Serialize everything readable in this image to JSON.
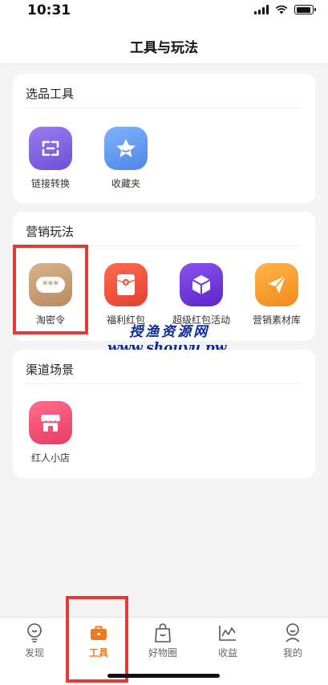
{
  "status_bar": {
    "time": "10:31"
  },
  "header": {
    "title": "工具与玩法"
  },
  "sections": [
    {
      "title": "选品工具",
      "items": [
        {
          "label": "链接转换",
          "icon": "link-convert-icon",
          "color": "#7b5fe3"
        },
        {
          "label": "收藏夹",
          "icon": "star-icon",
          "color": "#5f95ef"
        }
      ]
    },
    {
      "title": "营销玩法",
      "items": [
        {
          "label": "淘密令",
          "icon": "password-dots-icon",
          "color": "#c9a074"
        },
        {
          "label": "福利红包",
          "icon": "red-envelope-icon",
          "color": "#ef5139"
        },
        {
          "label": "超级红包活动",
          "icon": "cube-icon",
          "color": "#6e37da"
        },
        {
          "label": "营销素材库",
          "icon": "paper-plane-icon",
          "color": "#f79f2f"
        }
      ]
    },
    {
      "title": "渠道场景",
      "items": [
        {
          "label": "红人小店",
          "icon": "shop-icon",
          "color": "#ef5276"
        }
      ]
    }
  ],
  "watermark": {
    "line1": "授渔资源网",
    "line2": "www.shouyu.pw"
  },
  "tabs": [
    {
      "label": "发现",
      "icon": "bulb-icon",
      "active": false
    },
    {
      "label": "工具",
      "icon": "briefcase-icon",
      "active": true
    },
    {
      "label": "好物圈",
      "icon": "bag-icon",
      "active": false
    },
    {
      "label": "收益",
      "icon": "chart-icon",
      "active": false
    },
    {
      "label": "我的",
      "icon": "user-icon",
      "active": false
    }
  ],
  "colors": {
    "accent": "#f07a1f",
    "highlight": "#e83a34",
    "watermark": "#0a2a9c"
  }
}
